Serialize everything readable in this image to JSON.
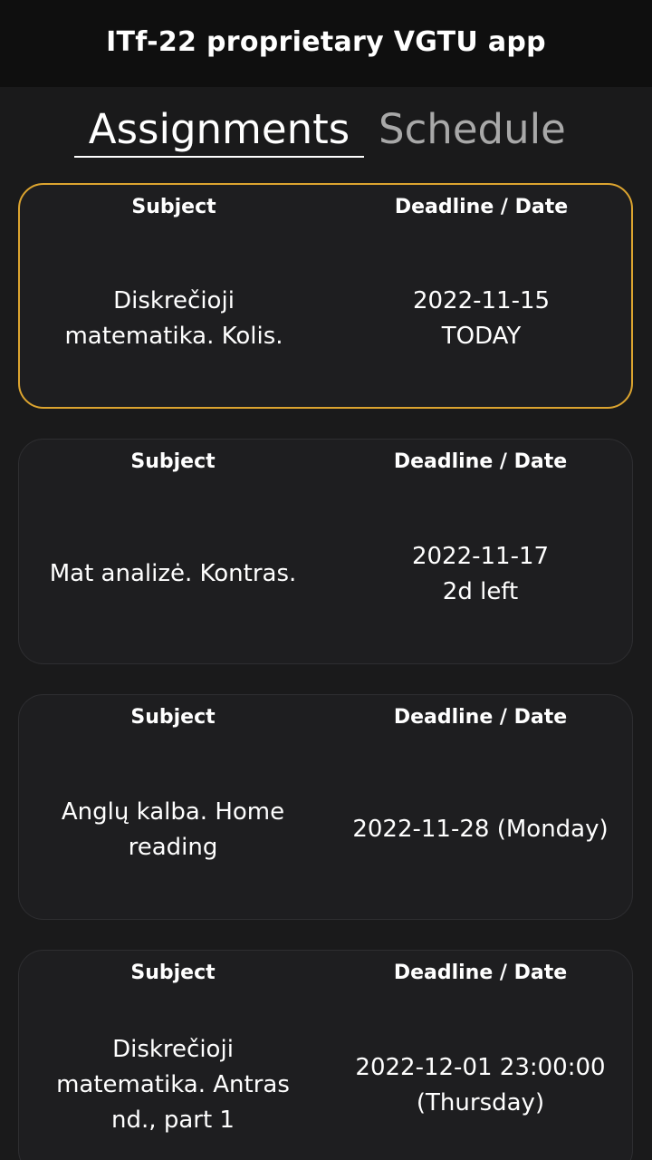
{
  "appbar": {
    "title": "ITf-22 proprietary VGTU app"
  },
  "tabs": [
    {
      "label": "Assignments",
      "active": true
    },
    {
      "label": "Schedule",
      "active": false
    }
  ],
  "columns": {
    "subject": "Subject",
    "deadline": "Deadline / Date"
  },
  "assignments": [
    {
      "subject": "Diskrečioji matematika. Kolis.",
      "date": "2022-11-15",
      "note": "TODAY",
      "highlighted": true
    },
    {
      "subject": "Mat analizė. Kontras.",
      "date": "2022-11-17",
      "note": "2d left",
      "highlighted": false
    },
    {
      "subject": "Anglų kalba. Home reading",
      "date": "2022-11-28 (Monday)",
      "note": "",
      "highlighted": false
    },
    {
      "subject": "Diskrečioji matematika. Antras nd., part 1",
      "date": "2022-12-01 23:00:00",
      "note": "(Thursday)",
      "highlighted": false
    }
  ],
  "colors": {
    "highlight_border": "#dca42f",
    "background": "#1a1a1b",
    "appbar": "#0f0f0f",
    "inactive_tab": "#a8a8a8"
  }
}
